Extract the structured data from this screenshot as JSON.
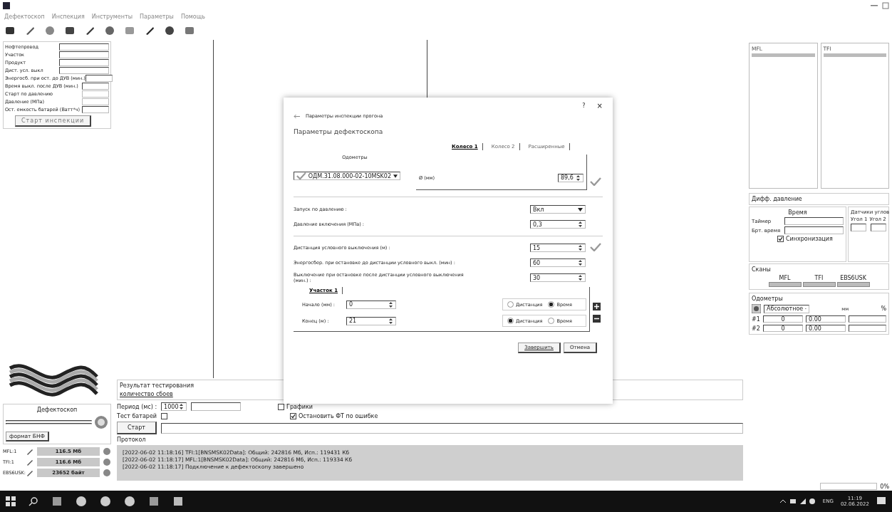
{
  "menu": [
    "Дефектоскоп",
    "Инспекция",
    "Инструменты",
    "Параметры",
    "Помощь"
  ],
  "inspection_form": {
    "fields": [
      {
        "label": "Нефтепровод",
        "kind": "wide"
      },
      {
        "label": "Участок",
        "kind": "wide"
      },
      {
        "label": "Продукт",
        "kind": "wide"
      },
      {
        "label": "Дист. усл. выкл",
        "kind": "wide"
      },
      {
        "label": "Энергосб. при ост. до ДУВ (мин.)",
        "kind": "narrow"
      },
      {
        "label": "Время выкл. после ДУВ (мин.)",
        "kind": "narrow"
      },
      {
        "label": "Старт по давлению",
        "kind": "flat"
      },
      {
        "label": "Давление (МПа)",
        "kind": "flat"
      },
      {
        "label": "Ост. емкость батарей (Ватт*ч)",
        "kind": "narrow"
      }
    ],
    "start_button": "Старт инспекции"
  },
  "device": {
    "title": "Дефектоскоп",
    "format_button": "формат БНФ"
  },
  "memory": [
    {
      "name": "MFL:1",
      "value": "116.5 Мб"
    },
    {
      "name": "TFI:1",
      "value": "116.6 Мб"
    },
    {
      "name": "EBS6USK:",
      "value": "23652 байт"
    }
  ],
  "test": {
    "title": "Результат тестирования",
    "link": "количество сбоев",
    "period_label": "Период (мс) :",
    "period": "1000",
    "checkboxes": [
      {
        "label": "Графики",
        "checked": false
      },
      {
        "label": "Остановить ФТ по ошибке",
        "checked": true
      }
    ],
    "battery_label": "Тест батарей",
    "battery_checked": false,
    "start_button": "Старт"
  },
  "protocol": {
    "title": "Протокол",
    "lines": [
      "[2022-06-02 11:18:16] TFI:1[BNSMSK02Data]: Общий: 242816 Мб, Исп.: 119431 Кб",
      "[2022-06-02 11:18:17] MFL:1[BNSMSK02Data]: Общий: 242816 Мб, Исп.: 119334 Кб",
      "[2022-06-02 11:18:17] Подключение к дефектоскопу завершено"
    ]
  },
  "right": {
    "channels": [
      "MFL",
      "TFI"
    ],
    "diff_title": "Дифф. давление",
    "time_title": "Время",
    "timer_label": "Таймер",
    "time_label": "Брт. время",
    "sync": {
      "label": "Синхронизация",
      "checked": true
    },
    "angles_title": "Датчики углов",
    "angles": [
      "Угол 1",
      "Угол 2"
    ],
    "scans_title": "Сканы",
    "scans": [
      "MFL",
      "TFI",
      "EBS6USK"
    ],
    "odo_title": "Одометры",
    "odo_mode": "Абсолютное",
    "odo_unit": "мм",
    "odo_percent": "%",
    "odometers": [
      {
        "name": "#1",
        "count": "0",
        "value": "0.00"
      },
      {
        "name": "#2",
        "count": "0",
        "value": "0.00"
      }
    ]
  },
  "dialog": {
    "help": "?",
    "close": "×",
    "caption": "Параметры инспекции прогона",
    "title": "Параметры дефектоскопа",
    "odometers_label": "Одометры",
    "odometer": "ОДМ.31.08.000-02-10MSK02",
    "tabs": [
      {
        "label": "Колесо 1",
        "selected": true
      },
      {
        "label": "Колесо 2",
        "selected": false
      },
      {
        "label": "Расширенные",
        "selected": false
      }
    ],
    "diameter_label": "Ø (мм)",
    "diameter": "89,6",
    "params": [
      {
        "label": "Запуск по давлению :",
        "value": "Вкл",
        "kind": "select",
        "ok": false
      },
      {
        "label": "Давление включения (МПа) :",
        "value": "0,3",
        "kind": "spin",
        "ok": false
      },
      {
        "label": "Дистанция условного выключения (м) :",
        "value": "15",
        "kind": "spin",
        "ok": true
      },
      {
        "label": "Энергосбер. при остановке до дистанции условного выкл. (мин) :",
        "value": "60",
        "kind": "spin",
        "ok": false
      },
      {
        "label": "Выключение при остановке после дистанции условного выключения (мин.) :",
        "value": "30",
        "kind": "spin",
        "ok": false
      }
    ],
    "section_tab": "Участок 1",
    "section": [
      {
        "label": "Начало (мм) :",
        "value": "0",
        "radios": [
          {
            "label": "Дистанция",
            "selected": false
          },
          {
            "label": "Время",
            "selected": true
          }
        ]
      },
      {
        "label": "Конец (м) :",
        "value": "21",
        "radios": [
          {
            "label": "Дистанция",
            "selected": true
          },
          {
            "label": "Время",
            "selected": false
          }
        ]
      }
    ],
    "finish": "Завершить",
    "cancel": "Отмена"
  },
  "status": {
    "progress": "0%",
    "level": 0
  },
  "taskbar": {
    "language": "ENG",
    "time": "11:19",
    "date": "02.06.2022"
  }
}
